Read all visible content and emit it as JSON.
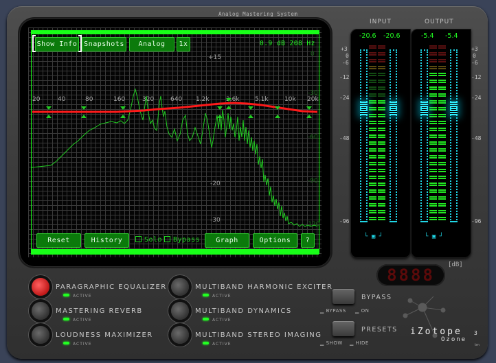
{
  "app": {
    "subtitle": "Analog Mastering System",
    "brand": "iZotope",
    "product": "Ozone",
    "version": "3",
    "trademark": "tm"
  },
  "toolbar": {
    "show_info": "Show Info",
    "snapshots": "Snapshots",
    "analog": "Analog",
    "zoom": "1x",
    "readout": "0.9 dB 208 Hz"
  },
  "eq_graph": {
    "left_scale": [
      "+15",
      "-10",
      "-20",
      "-30"
    ],
    "right_scale": [
      "0",
      "-30",
      "-60",
      "-90",
      "-120"
    ],
    "freq_labels": [
      "20",
      "40",
      "80",
      "160",
      "320",
      "640",
      "1.2k",
      "2.6k",
      "5.1k",
      "10k",
      "20k"
    ],
    "colors": {
      "eq_curve": "#ff1a1a",
      "spectrum": "#22cc22",
      "grid": "#3a3a3a",
      "frame": "#18ff18"
    }
  },
  "bottom_bar": {
    "reset": "Reset",
    "history": "History",
    "solo": "Solo",
    "bypass": "Bypass",
    "graph": "Graph",
    "options": "Options",
    "help": "?"
  },
  "meters": {
    "input_label": "INPUT",
    "output_label": "OUTPUT",
    "input_left": "-20.6",
    "input_right": "-20.6",
    "output_left": "-5.4",
    "output_right": "-5.4",
    "scale": [
      "+3",
      "0",
      "-6",
      "-12",
      "-24",
      "-48",
      "-96"
    ],
    "led_display": "8888",
    "unit": "[dB]"
  },
  "modules": [
    {
      "name": "PARAGRAPHIC EQUALIZER",
      "status": "ACTIVE",
      "selected": true
    },
    {
      "name": "MASTERING REVERB",
      "status": "ACTIVE",
      "selected": false
    },
    {
      "name": "LOUDNESS MAXIMIZER",
      "status": "ACTIVE",
      "selected": false
    },
    {
      "name": "MULTIBAND HARMONIC EXCITER",
      "status": "ACTIVE",
      "selected": false
    },
    {
      "name": "MULTIBAND DYNAMICS",
      "status": "ACTIVE",
      "selected": false
    },
    {
      "name": "MULTIBAND STEREO IMAGING",
      "status": "ACTIVE",
      "selected": false
    }
  ],
  "controls": {
    "bypass_label": "BYPASS",
    "bypass_opt1": "BYPASS",
    "bypass_opt2": "ON",
    "presets_label": "PRESETS",
    "presets_opt1": "SHOW",
    "presets_opt2": "HIDE"
  }
}
